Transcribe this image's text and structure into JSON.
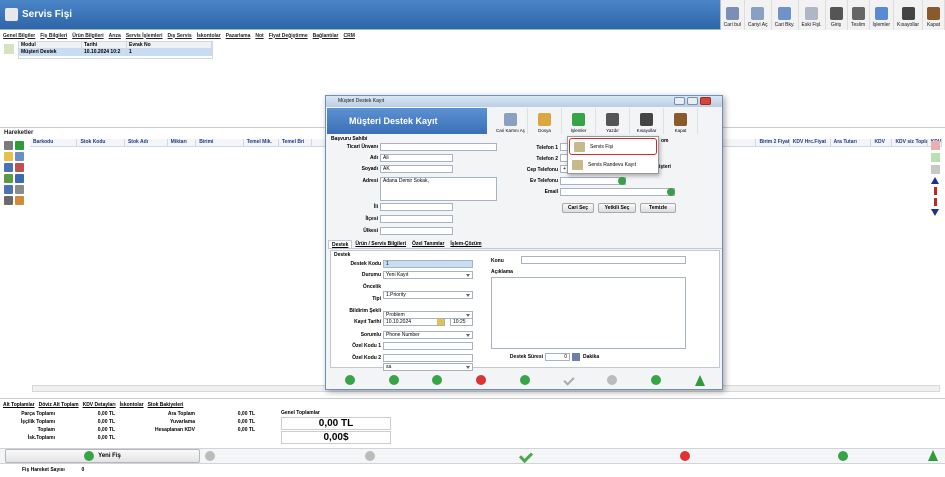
{
  "app": {
    "title": "Servis Fişi"
  },
  "toolbar": [
    {
      "label": "Cari bul",
      "icon": "user-search-icon"
    },
    {
      "label": "Cariyi Aç",
      "icon": "user-open-icon"
    },
    {
      "label": "Cari Bky.",
      "icon": "user-balance-icon"
    },
    {
      "label": "Eski Fişl.",
      "icon": "old-slips-icon"
    },
    {
      "label": "Giriş",
      "icon": "printer-icon"
    },
    {
      "label": "Teslim",
      "icon": "printer-deliver-icon"
    },
    {
      "label": "İşlemler",
      "icon": "operations-icon"
    },
    {
      "label": "Kısayollar",
      "icon": "shortcut-icon"
    },
    {
      "label": "Kapat",
      "icon": "close-door-icon"
    }
  ],
  "menu": [
    "Genel Bilgiler",
    "Fiş Bilgileri",
    "Ürün Bilgileri",
    "Arıza",
    "Servis İşlemleri",
    "Dış Servis",
    "İskontolar",
    "Pazarlama",
    "Not",
    "Fiyat Değiştirme",
    "Bağlantılar",
    "CRM"
  ],
  "links_grid": {
    "headers": [
      "Modul",
      "Tarihi",
      "Evrak No"
    ],
    "row": [
      "Müşteri Destek",
      "10.10.2024 10:2",
      "1"
    ]
  },
  "hareketler": {
    "title": "Hareketler",
    "columns": [
      "Barkodu",
      "Stok Kodu",
      "Stok Adı",
      "Miktarı",
      "Birimi",
      "Temel Mik.",
      "Temel Bri",
      "",
      "Birim 2 Fiyatı",
      "KDV Hrc.Fiyat",
      "Ara Tutarı",
      "KDV",
      "KDV siz Toplam",
      "KDV"
    ]
  },
  "bottom_tabs": [
    "Alt Toplamlar",
    "Döviz Alt Toplam",
    "KDV Detayları",
    "İskontolar",
    "Stok Bakiyeleri"
  ],
  "totals": {
    "col1": [
      {
        "label": "Parça Toplamı",
        "value": "0,00 TL"
      },
      {
        "label": "İşçilik Toplamı",
        "value": "0,00 TL"
      },
      {
        "label": "Toplam",
        "value": "0,00 TL"
      },
      {
        "label": "İsk.Toplamı",
        "value": "0,00 TL"
      }
    ],
    "col2": [
      {
        "label": "Ara Toplam",
        "value": "0,00 TL"
      },
      {
        "label": "Yuvarlama",
        "value": "0,00 TL"
      },
      {
        "label": "Hesaplanan KDV",
        "value": "0,00 TL"
      }
    ],
    "general_label": "Genel Toplamlar",
    "general_tl": "0,00 TL",
    "general_usd": "0,00$"
  },
  "bottom": {
    "new_button": "Yeni Fiş",
    "status_label": "Fiş Hareket Sayısı",
    "status_value": "0"
  },
  "dialog": {
    "window_title": "Müşteri Destek Kayıt",
    "header": "Müşteri Destek Kayıt",
    "buttons": [
      "Cari Kartını Aç",
      "Dosya",
      "İşlemler",
      "Yazdır",
      "Kısayollar",
      "Kapat"
    ],
    "section": "Başvuru Sahibi",
    "fields": {
      "ticari_label": "Ticari Ünvanı",
      "ticari": "",
      "adi_label": "Adı",
      "adi": "Ali",
      "soyadi_label": "Soyadı",
      "soyadi": "AK",
      "adres_label": "Adresi",
      "adres": "Adana Demir Sokak,",
      "il_label": "İli",
      "ilce_label": "İlçesi",
      "ulke_label": "Ülkesi",
      "tel1_label": "Telefon 1",
      "tel2_label": "Telefon 2",
      "cep_label": "Cep Telefonu",
      "cep": "+",
      "ev_label": "Ev Telefonu",
      "email_label": "Email"
    },
    "select_buttons": [
      "Cari Seç",
      "Yetkili Seç",
      "Temizle"
    ],
    "tabs": [
      "Destek",
      "Ürün / Servis Bilgileri",
      "Özel Tanımlar",
      "İşlem-Çözüm"
    ],
    "destek": {
      "group": "Destek",
      "kod_label": "Destek Kodu",
      "kod": "1",
      "durum_label": "Durumu",
      "durum": "Yeni Kayıt",
      "oncelik_label": "Öncelik",
      "oncelik": "1.Priority",
      "tipi_label": "Tipi",
      "tipi": "Problem",
      "bildirim_label": "Bildirim Şekli",
      "bildirim": "Phone Number",
      "tarih_label": "Kayıt Tarihi",
      "tarih": "10.10.2024",
      "saat": "10:25",
      "sorumlu_label": "Sorumlu",
      "sorumlu": "sa",
      "ozel1_label": "Özel Kodu 1",
      "ozel2_label": "Özel Kodu 2",
      "konu_label": "Konu",
      "aciklama_label": "Açıklama",
      "sure_label": "Destek Süresi",
      "sure": "0",
      "dakika": "Dakika"
    },
    "menu_popup": [
      "Servis Fişi",
      "Servis Randevu Kayıt"
    ],
    "behind_text": [
      "om",
      "işteri"
    ]
  }
}
